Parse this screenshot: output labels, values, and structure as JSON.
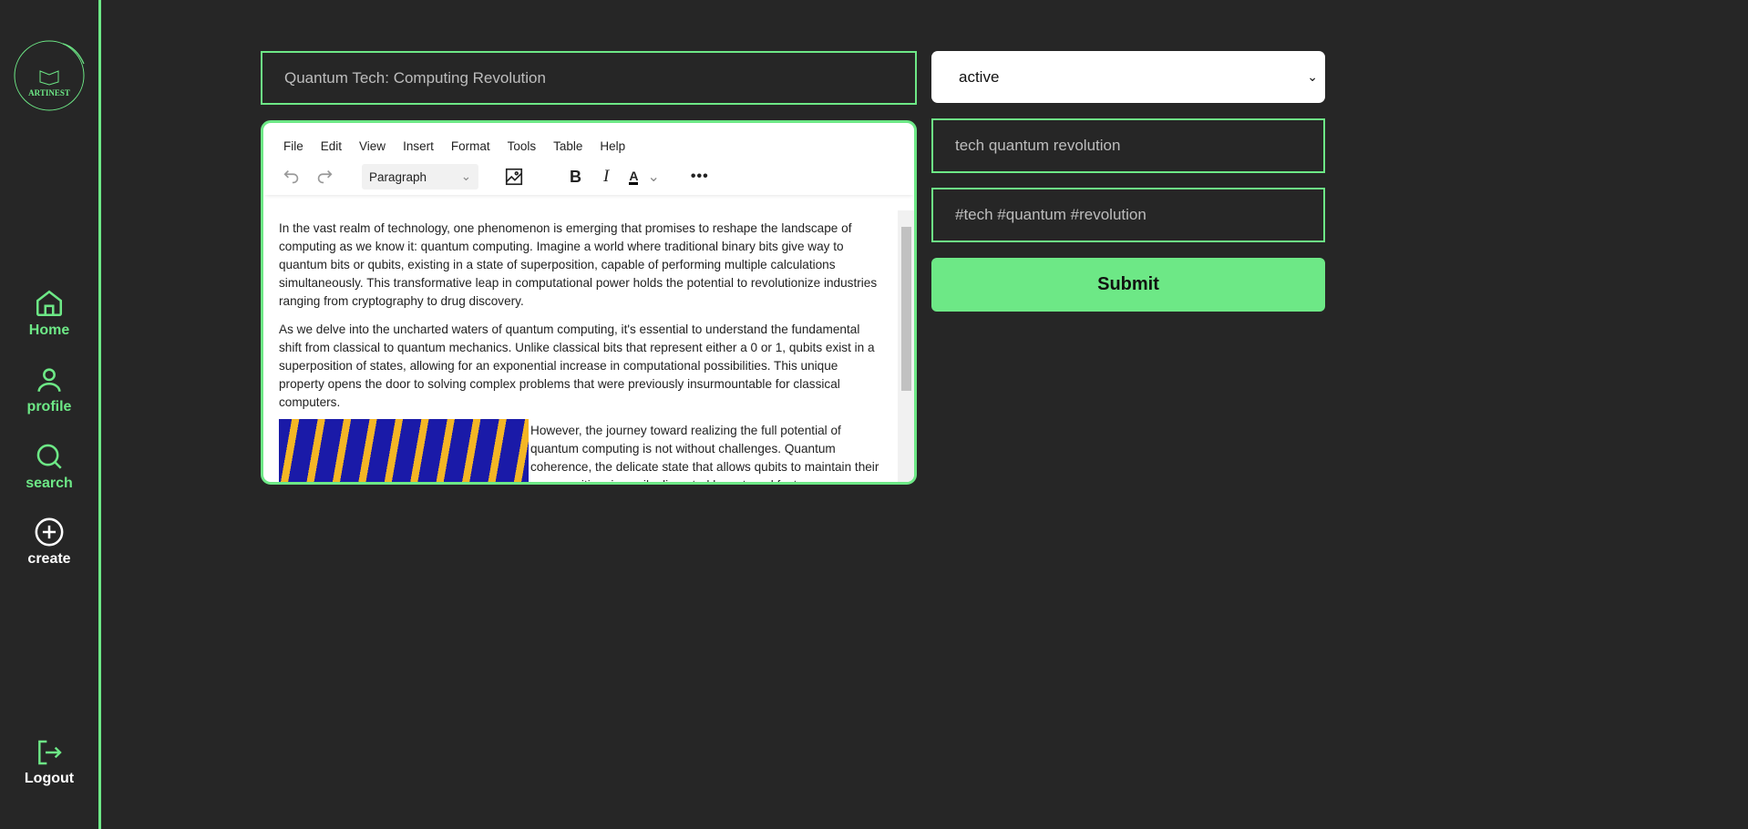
{
  "brand": {
    "logo_text": "ARTINEST"
  },
  "sidebar": {
    "items": [
      {
        "label": "Home",
        "icon": "home-icon"
      },
      {
        "label": "profile",
        "icon": "user-icon"
      },
      {
        "label": "search",
        "icon": "search-icon"
      },
      {
        "label": "create",
        "icon": "plus-circle-icon"
      }
    ],
    "logout": "Logout"
  },
  "form": {
    "title_value": "Quantum Tech: Computing Revolution",
    "status_selected": "active",
    "keywords_value": "tech quantum revolution",
    "hashtags_value": "#tech #quantum #revolution",
    "submit_label": "Submit"
  },
  "editor": {
    "menu": [
      "File",
      "Edit",
      "View",
      "Insert",
      "Format",
      "Tools",
      "Table",
      "Help"
    ],
    "block_format": "Paragraph",
    "paragraphs": [
      "In the vast realm of technology, one phenomenon is emerging that promises to reshape the landscape of computing as we know it: quantum computing. Imagine a world where traditional binary bits give way to quantum bits or qubits, existing in a state of superposition, capable of performing multiple calculations simultaneously. This transformative leap in computational power holds the potential to revolutionize industries ranging from cryptography to drug discovery.",
      "As we delve into the uncharted waters of quantum computing, it's essential to understand the fundamental shift from classical to quantum mechanics. Unlike classical bits that represent either a 0 or 1, qubits exist in a superposition of states, allowing for an exponential increase in computational possibilities. This unique property opens the door to solving complex problems that were previously insurmountable for classical computers.",
      "However, the journey toward realizing the full potential of quantum computing is not without challenges. Quantum coherence, the delicate state that allows qubits to maintain their superposition, is easily disrupted by external factors"
    ]
  },
  "colors": {
    "accent": "#6de886",
    "background": "#262626"
  }
}
